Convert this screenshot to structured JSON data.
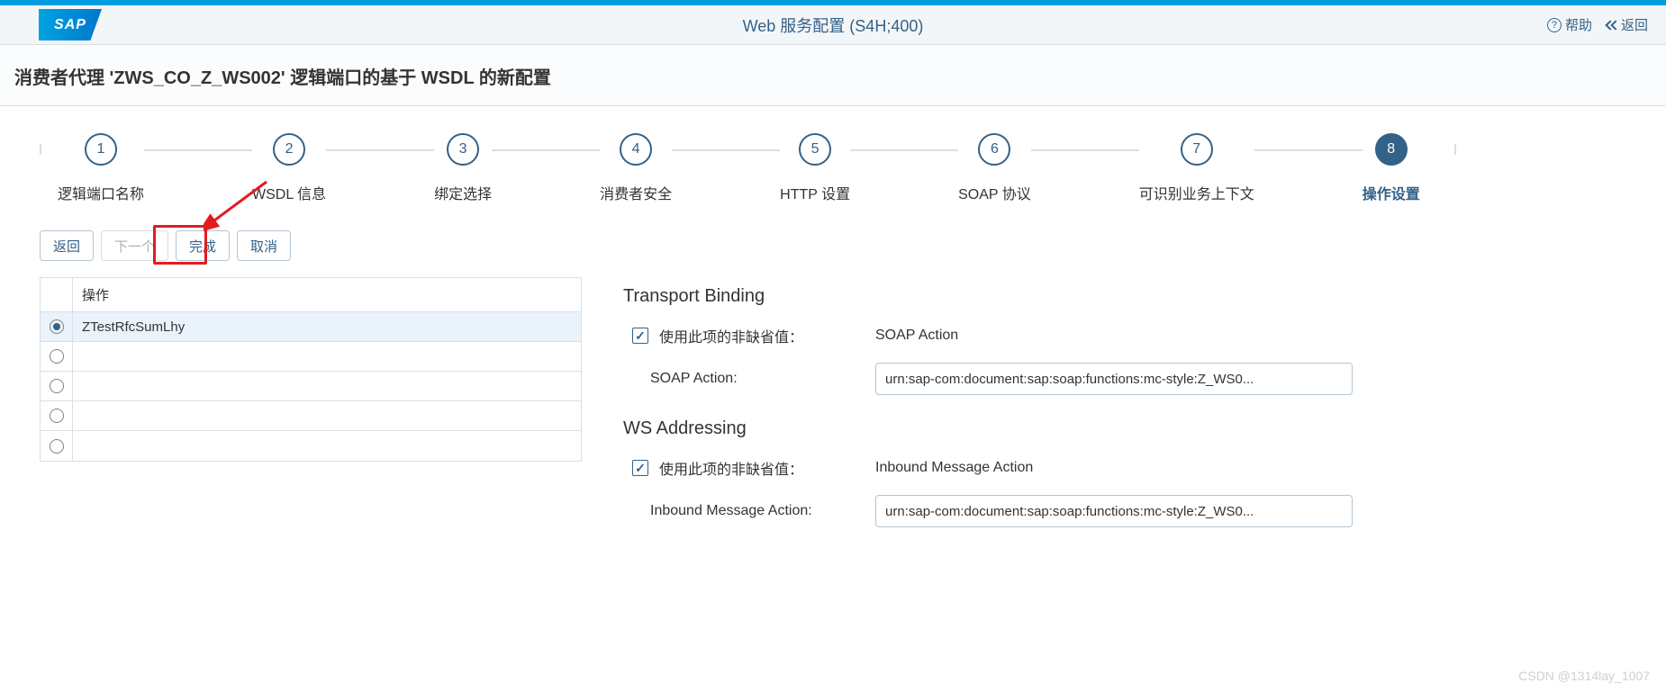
{
  "shell": {
    "logo_text": "SAP",
    "title": "Web 服务配置 (S4H;400)",
    "help_label": "帮助",
    "back_label": "返回"
  },
  "page_title": "消费者代理 'ZWS_CO_Z_WS002' 逻辑端口的基于 WSDL 的新配置",
  "wizard": {
    "steps": [
      {
        "num": "1",
        "label": "逻辑端口名称",
        "active": false
      },
      {
        "num": "2",
        "label": "WSDL 信息",
        "active": false
      },
      {
        "num": "3",
        "label": "绑定选择",
        "active": false
      },
      {
        "num": "4",
        "label": "消费者安全",
        "active": false
      },
      {
        "num": "5",
        "label": "HTTP 设置",
        "active": false
      },
      {
        "num": "6",
        "label": "SOAP 协议",
        "active": false
      },
      {
        "num": "7",
        "label": "可识别业务上下文",
        "active": false
      },
      {
        "num": "8",
        "label": "操作设置",
        "active": true
      }
    ]
  },
  "buttons": {
    "back": "返回",
    "next": "下一个",
    "finish": "完成",
    "cancel": "取消"
  },
  "operations": {
    "header": "操作",
    "rows": [
      {
        "name": "ZTestRfcSumLhy",
        "selected": true
      },
      {
        "name": "",
        "selected": false
      },
      {
        "name": "",
        "selected": false
      },
      {
        "name": "",
        "selected": false
      },
      {
        "name": "",
        "selected": false
      }
    ]
  },
  "transport": {
    "section_title": "Transport Binding",
    "use_non_default_label": "使用此项的非缺省值：",
    "use_non_default_target": "SOAP Action",
    "soap_action_label": "SOAP Action:",
    "soap_action_value": "urn:sap-com:document:sap:soap:functions:mc-style:Z_WS0..."
  },
  "ws_addressing": {
    "section_title": "WS Addressing",
    "use_non_default_label": "使用此项的非缺省值：",
    "use_non_default_target": "Inbound Message Action",
    "inbound_label": "Inbound Message Action:",
    "inbound_value": "urn:sap-com:document:sap:soap:functions:mc-style:Z_WS0..."
  },
  "watermark": "CSDN @1314lay_1007"
}
